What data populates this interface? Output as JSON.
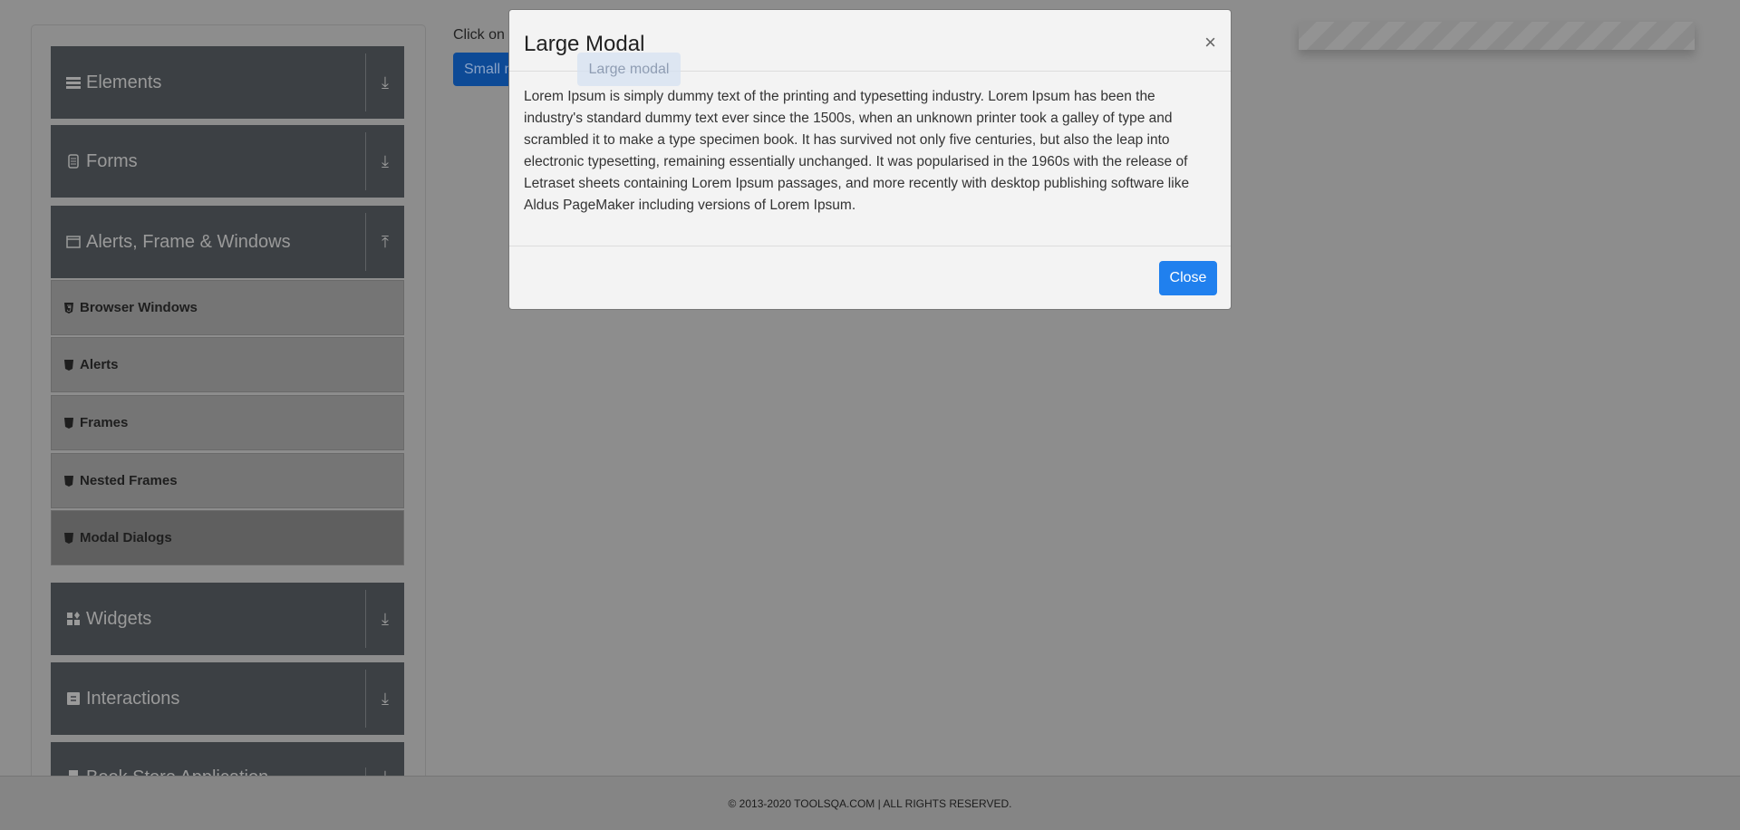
{
  "sidebar": {
    "groups": [
      {
        "label": "Elements",
        "icon": "bars-icon"
      },
      {
        "label": "Forms",
        "icon": "file-icon"
      },
      {
        "label": "Alerts, Frame & Windows",
        "icon": "window-icon"
      },
      {
        "label": "Widgets",
        "icon": "widgets-icon"
      },
      {
        "label": "Interactions",
        "icon": "sync-icon"
      },
      {
        "label": "Book Store Application",
        "icon": "book-icon"
      }
    ],
    "subitems": [
      {
        "label": "Browser Windows"
      },
      {
        "label": "Alerts"
      },
      {
        "label": "Frames"
      },
      {
        "label": "Nested Frames"
      },
      {
        "label": "Modal Dialogs"
      }
    ]
  },
  "main": {
    "instruction": "Click on button to see modal",
    "small_modal_label": "Small modal",
    "large_modal_label": "Large modal"
  },
  "modal": {
    "title": "Large Modal",
    "close_x": "×",
    "body": "Lorem Ipsum is simply dummy text of the printing and typesetting industry. Lorem Ipsum has been the industry's standard dummy text ever since the 1500s, when an unknown printer took a galley of type and scrambled it to make a type specimen book. It has survived not only five centuries, but also the leap into electronic typesetting, remaining essentially unchanged. It was popularised in the 1960s with the release of Letraset sheets containing Lorem Ipsum passages, and more recently with desktop publishing software like Aldus PageMaker including versions of Lorem Ipsum.",
    "close_label": "Close"
  },
  "footer": {
    "text": "© 2013-2020 TOOLSQA.COM | ALL RIGHTS RESERVED."
  },
  "colors": {
    "primary": "#2080ee",
    "sidebar_group": "#3c4044",
    "backdrop": "#8d8d8d"
  }
}
